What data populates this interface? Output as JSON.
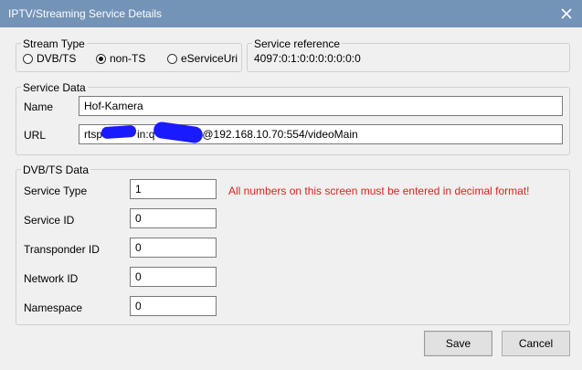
{
  "window": {
    "title": "IPTV/Streaming Service Details",
    "close_icon": "close-icon"
  },
  "stream_type": {
    "label": "Stream Type",
    "options": [
      {
        "label": "DVB/TS",
        "checked": false
      },
      {
        "label": "non-TS",
        "checked": true
      },
      {
        "label": "eServiceUri",
        "checked": false
      }
    ]
  },
  "service_reference": {
    "label": "Service reference",
    "value": "4097:0:1:0:0:0:0:0:0:0"
  },
  "service_data": {
    "label": "Service Data",
    "name_label": "Name",
    "name_value": "Hof-Kamera",
    "url_label": "URL",
    "url_prefix": "rtsp",
    "url_mid": "in:q",
    "url_suffix": "@192.168.10.70:554/videoMain"
  },
  "dvbts_data": {
    "label": "DVB/TS Data",
    "warning": "All numbers on this screen must be entered in decimal format!",
    "warning_color": "#e0201c",
    "fields": [
      {
        "label": "Service Type",
        "value": "1"
      },
      {
        "label": "Service ID",
        "value": "0"
      },
      {
        "label": "Transponder ID",
        "value": "0"
      },
      {
        "label": "Network ID",
        "value": "0"
      },
      {
        "label": "Namespace",
        "value": "0"
      }
    ]
  },
  "buttons": {
    "save": "Save",
    "cancel": "Cancel"
  },
  "colors": {
    "titlebar": "#7393b7",
    "window_bg": "#f0f0f0",
    "redaction": "#1a1aff"
  }
}
